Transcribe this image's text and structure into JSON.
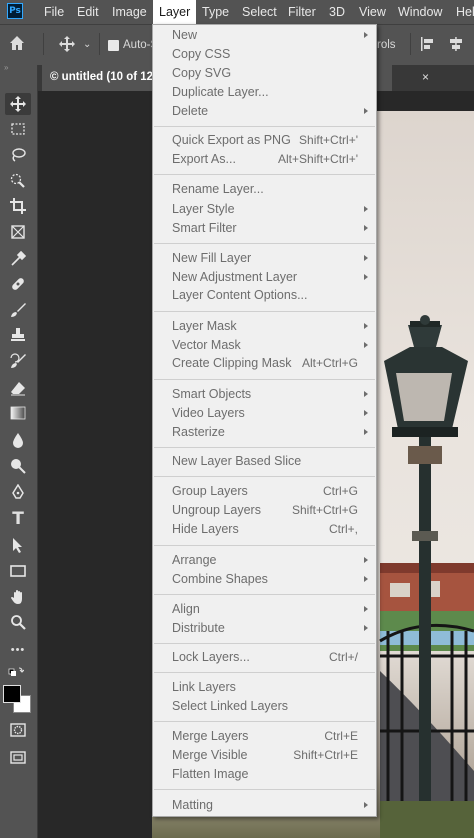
{
  "menubar": {
    "app_logo": "Ps",
    "items": [
      "File",
      "Edit",
      "Image",
      "Layer",
      "Type",
      "Select",
      "Filter",
      "3D",
      "View",
      "Window",
      "Hel"
    ],
    "active": "Layer"
  },
  "optionsbar": {
    "auto_select_label": "Auto-S",
    "controls_fragment": "rols"
  },
  "document": {
    "tab_title": "© untitled (10 of 12",
    "close_glyph": "×"
  },
  "layer_menu": {
    "items": [
      {
        "label": "New",
        "submenu": true
      },
      {
        "label": "Copy CSS"
      },
      {
        "label": "Copy SVG"
      },
      {
        "label": "Duplicate Layer..."
      },
      {
        "label": "Delete",
        "submenu": true
      },
      {
        "label": "Quick Export as PNG",
        "shortcut": "Shift+Ctrl+'"
      },
      {
        "label": "Export As...",
        "shortcut": "Alt+Shift+Ctrl+'"
      },
      {
        "label": "Rename Layer..."
      },
      {
        "label": "Layer Style",
        "submenu": true
      },
      {
        "label": "Smart Filter",
        "submenu": true
      },
      {
        "label": "New Fill Layer",
        "submenu": true
      },
      {
        "label": "New Adjustment Layer",
        "submenu": true
      },
      {
        "label": "Layer Content Options..."
      },
      {
        "label": "Layer Mask",
        "submenu": true
      },
      {
        "label": "Vector Mask",
        "submenu": true
      },
      {
        "label": "Create Clipping Mask",
        "shortcut": "Alt+Ctrl+G"
      },
      {
        "label": "Smart Objects",
        "submenu": true
      },
      {
        "label": "Video Layers",
        "submenu": true
      },
      {
        "label": "Rasterize",
        "submenu": true
      },
      {
        "label": "New Layer Based Slice"
      },
      {
        "label": "Group Layers",
        "shortcut": "Ctrl+G"
      },
      {
        "label": "Ungroup Layers",
        "shortcut": "Shift+Ctrl+G"
      },
      {
        "label": "Hide Layers",
        "shortcut": "Ctrl+,"
      },
      {
        "label": "Arrange",
        "submenu": true
      },
      {
        "label": "Combine Shapes",
        "submenu": true
      },
      {
        "label": "Align",
        "submenu": true
      },
      {
        "label": "Distribute",
        "submenu": true
      },
      {
        "label": "Lock Layers...",
        "shortcut": "Ctrl+/"
      },
      {
        "label": "Link Layers"
      },
      {
        "label": "Select Linked Layers"
      },
      {
        "label": "Merge Layers",
        "shortcut": "Ctrl+E"
      },
      {
        "label": "Merge Visible",
        "shortcut": "Shift+Ctrl+E"
      },
      {
        "label": "Flatten Image"
      },
      {
        "label": "Matting",
        "submenu": true
      }
    ]
  },
  "tools": [
    "move-tool",
    "marquee-tool",
    "lasso-tool",
    "quick-selection-tool",
    "crop-tool",
    "frame-tool",
    "eyedropper-tool",
    "spot-healing-tool",
    "brush-tool",
    "clone-stamp-tool",
    "history-brush-tool",
    "eraser-tool",
    "gradient-tool",
    "blur-tool",
    "dodge-tool",
    "pen-tool",
    "type-tool",
    "path-selection-tool",
    "rectangle-tool",
    "hand-tool",
    "zoom-tool",
    "more-tools",
    "color-swatches",
    "quick-mask-mode",
    "screen-mode"
  ],
  "tools_glyphs": {
    "type": "T",
    "more": "•••"
  },
  "colors": {
    "ui_dark": "#535353",
    "canvas_bg": "#282828",
    "menu_bg": "#f0f0f0",
    "menu_text_disabled": "#6d6d6d",
    "ps_blue": "#31a8ff"
  }
}
